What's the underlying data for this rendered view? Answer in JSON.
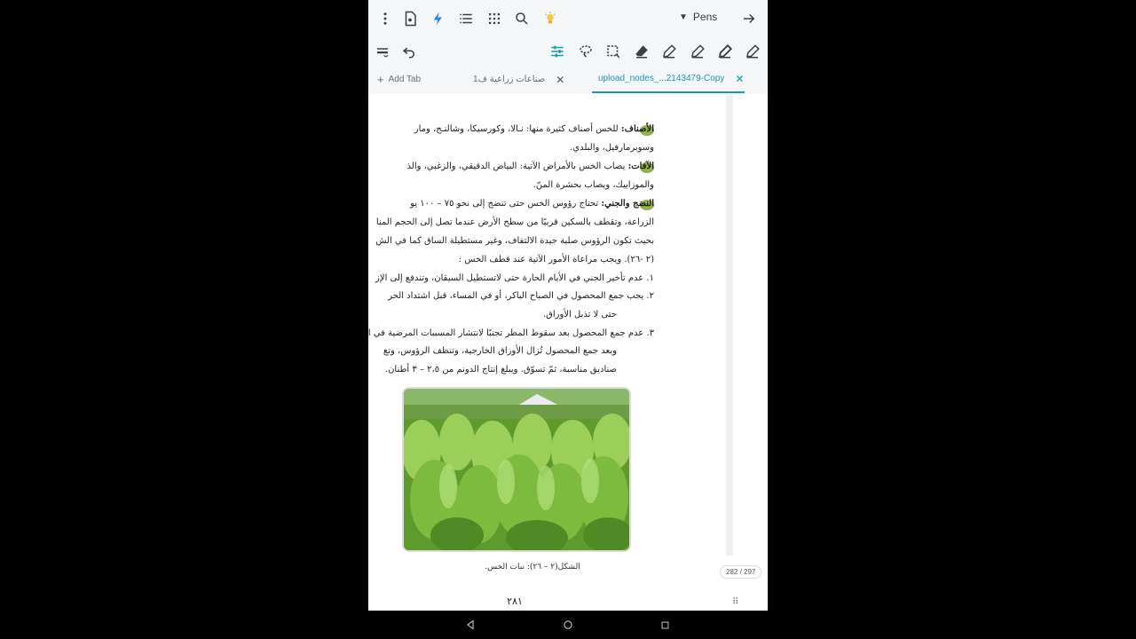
{
  "header": {
    "pens_label": "Pens"
  },
  "tabs": {
    "add_label": "Add Tab",
    "items": [
      {
        "label": "صناعات زراعية ف1"
      },
      {
        "label": "upload_nodes_...2143479-Copy"
      }
    ],
    "close_glyph": "✕"
  },
  "document": {
    "lines": [
      {
        "label": "الأصناف:",
        "text": " للخس أصناف كثيرة منها: نـالا، وكورسيكا، وشالنـج، ومار"
      },
      {
        "text": "وسوبرمارفيل، والبلدي."
      },
      {
        "label": "الآفات:",
        "text": " يصاب الخس بالأمراض الآتية: البياض الدقيقي، والزغبي، والذ"
      },
      {
        "text": "والموزاييك، ويصاب بحشرة المنّ."
      },
      {
        "label": "النضج والجني:",
        "text": " تحتاج رؤوس الخس حتى تنضج إلى نحو ٧٥ – ١٠٠ يو"
      },
      {
        "text": "الزراعة، وتقطف بالسكين قريبًا من سطح الأرض عندما تصل إلى الحجم المنا"
      },
      {
        "text": "بحيث تكون الرؤوس صلبة جيدة الالتفاف، وغير مستطيلة الساق كما في الش"
      },
      {
        "text": "(٢ -٢٦). ويجب مراعاة الأمور الآتية عند قطف الخس :"
      },
      {
        "text": "١.  عدم تأخير الجني في الأيام الحارة حتى لاتستطيل السيقان، وتندفع إلى الإز"
      },
      {
        "text": "٢.  يجب جمع المحصول في الصباح الباكر، أو في المساء، قبل اشتداد الحر"
      },
      {
        "text": "حتى لا تذبل الأوراق."
      },
      {
        "text": "٣.  عدم جمع المحصول بعد سقوط المطر تجنبًا لانتشار المسببات المرضية في الش"
      },
      {
        "text": "وبعد جمع المحصول تُزال الأوراق الخارجية، وتنظف الرؤوس، وتع"
      },
      {
        "text": "صناديق مناسبة، ثمّ تسوّق. ويبلغ إنتاج الدونم من ٢،٥ – ٣ أطنان."
      }
    ],
    "caption": "الشكل(٢ – ٢٦): نبات الخس.",
    "page_number": "٢٨١",
    "page_counter": "282 / 297"
  },
  "colors": {
    "accent": "#1a9aaa",
    "bullet": "#8fb34a",
    "pen_icon": "#1e88e5",
    "toolbar_bg": "#f4f6f7"
  }
}
